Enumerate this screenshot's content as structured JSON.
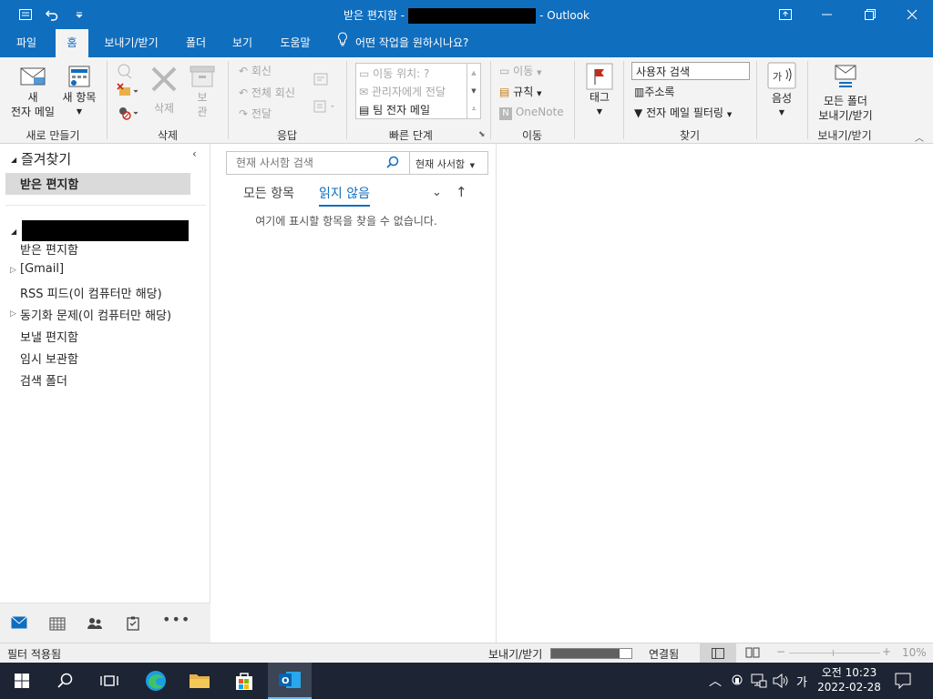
{
  "titlebar": {
    "title_prefix": "받은 편지함 -",
    "title_suffix": "-  Outlook"
  },
  "tabs": [
    {
      "label": "파일"
    },
    {
      "label": "홈"
    },
    {
      "label": "보내기/받기"
    },
    {
      "label": "폴더"
    },
    {
      "label": "보기"
    },
    {
      "label": "도움말"
    }
  ],
  "tellme": "어떤 작업을 원하시나요?",
  "ribbon": {
    "new_email_line1": "새",
    "new_email_line2": "전자 메일",
    "new_items": "새 항목",
    "group_new": "새로 만들기",
    "delete": "삭제",
    "archive_1": "보",
    "archive_2": "관",
    "group_delete": "삭제",
    "reply": "회신",
    "reply_all": "전체 회신",
    "forward": "전달",
    "group_respond": "응답",
    "qs_move": "이동 위치: ?",
    "qs_manager": "관리자에게 전달",
    "qs_team": "팀 전자 메일",
    "group_quicksteps": "빠른 단계",
    "move": "이동",
    "rules": "규칙",
    "onenote": "OneNote",
    "group_move": "이동",
    "tags": "태그",
    "search_people": "사용자 검색",
    "address_book": "주소록",
    "filter_email": "전자 메일 필터링",
    "group_find": "찾기",
    "speech": "음성",
    "send_receive_all_1": "모든 폴더",
    "send_receive_all_2": "보내기/받기",
    "group_send_receive": "보내기/받기"
  },
  "folders": {
    "favorites": "즐겨찾기",
    "fav_inbox": "받은 편지함",
    "items": [
      {
        "label": "받은 편지함",
        "arrow": ""
      },
      {
        "label": "[Gmail]",
        "arrow": "▷"
      },
      {
        "label": "RSS 피드(이 컴퓨터만 해당)",
        "arrow": ""
      },
      {
        "label": "동기화 문제(이 컴퓨터만 해당)",
        "arrow": "▷"
      },
      {
        "label": "보낼 편지함",
        "arrow": ""
      },
      {
        "label": "임시 보관함",
        "arrow": ""
      },
      {
        "label": "검색 폴더",
        "arrow": ""
      }
    ]
  },
  "msglist": {
    "search_placeholder": "현재 사서함 검색",
    "scope": "현재 사서함",
    "tab_all": "모든 항목",
    "tab_unread": "읽지 않음",
    "empty": "여기에 표시할 항목을 찾을 수 없습니다."
  },
  "status": {
    "filter": "필터 적용됨",
    "send_receive": "보내기/받기",
    "progress": 0.85,
    "connected": "연결됨",
    "zoom": "10%"
  },
  "taskbar": {
    "ime": "가",
    "time": "오전 10:23",
    "date": "2022-02-28"
  },
  "colors": {
    "accent": "#106ebe",
    "taskbar": "#1d2433"
  }
}
